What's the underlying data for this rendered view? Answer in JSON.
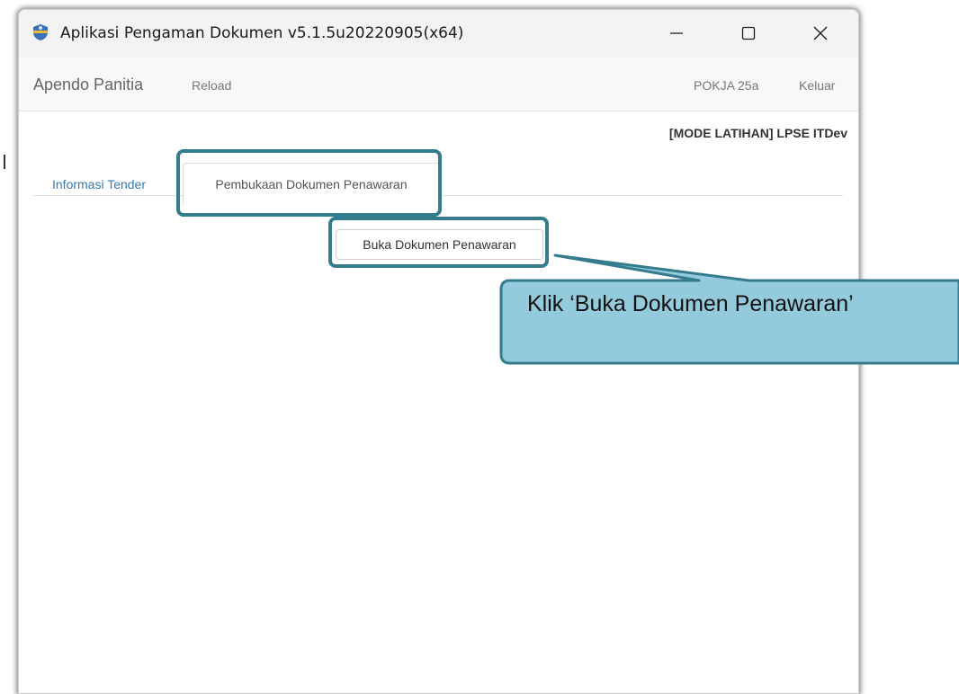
{
  "window": {
    "title": "Aplikasi Pengaman Dokumen v5.1.5u20220905(x64)",
    "app_icon": "shield-icon",
    "minimize_icon": "minimize-icon",
    "maximize_icon": "maximize-icon",
    "close_icon": "close-icon"
  },
  "menubar": {
    "brand": "Apendo Panitia",
    "reload": "Reload",
    "user": "POKJA 25a",
    "logout": "Keluar"
  },
  "mode_label": "[MODE LATIHAN] LPSE ITDev",
  "tabs": [
    {
      "label": "Informasi Tender",
      "active": false
    },
    {
      "label": "Pembukaan Dokumen Penawaran",
      "active": true
    }
  ],
  "open_button": "Buka Dokumen Penawaran",
  "annotation": {
    "text": "Klik ‘Buka Dokumen Penawaran’",
    "highlight_color": "#347b8e",
    "callout_fill": "#94cbdc"
  }
}
